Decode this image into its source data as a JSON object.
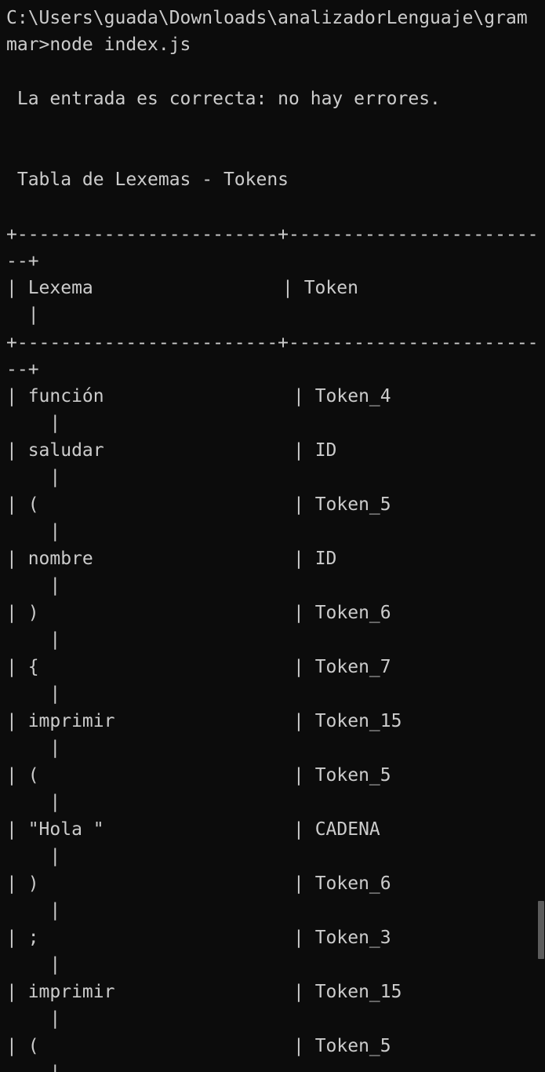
{
  "prompt": {
    "line1": "C:\\Users\\guada\\Downloads\\analizadorLenguaje\\gram",
    "line2": "mar>node index.js"
  },
  "messages": {
    "success": " La entrada es correcta: no hay errores.",
    "table_title": " Tabla de Lexemas - Tokens"
  },
  "table": {
    "border_top": "+------------------------+-----------------------",
    "border_top_wrap": "--+",
    "header_lexema": "| Lexema",
    "header_token": "| Token",
    "header_wrap": "  |",
    "border_mid": "+------------------------+-----------------------",
    "border_mid_wrap": "--+",
    "rows": [
      {
        "lexema": "función",
        "token": "Token_4"
      },
      {
        "lexema": "saludar",
        "token": "ID"
      },
      {
        "lexema": "(",
        "token": "Token_5"
      },
      {
        "lexema": "nombre",
        "token": "ID"
      },
      {
        "lexema": ")",
        "token": "Token_6"
      },
      {
        "lexema": "{",
        "token": "Token_7"
      },
      {
        "lexema": "imprimir",
        "token": "Token_15"
      },
      {
        "lexema": "(",
        "token": "Token_5"
      },
      {
        "lexema": "\"Hola \"",
        "token": "CADENA"
      },
      {
        "lexema": ")",
        "token": "Token_6"
      },
      {
        "lexema": ";",
        "token": "Token_3"
      },
      {
        "lexema": "imprimir",
        "token": "Token_15"
      },
      {
        "lexema": "(",
        "token": "Token_5"
      }
    ],
    "row_wrap": "    |"
  },
  "colors": {
    "background": "#0c0c0c",
    "foreground": "#cccccc",
    "scrollbar_thumb": "#5c5c5c"
  }
}
